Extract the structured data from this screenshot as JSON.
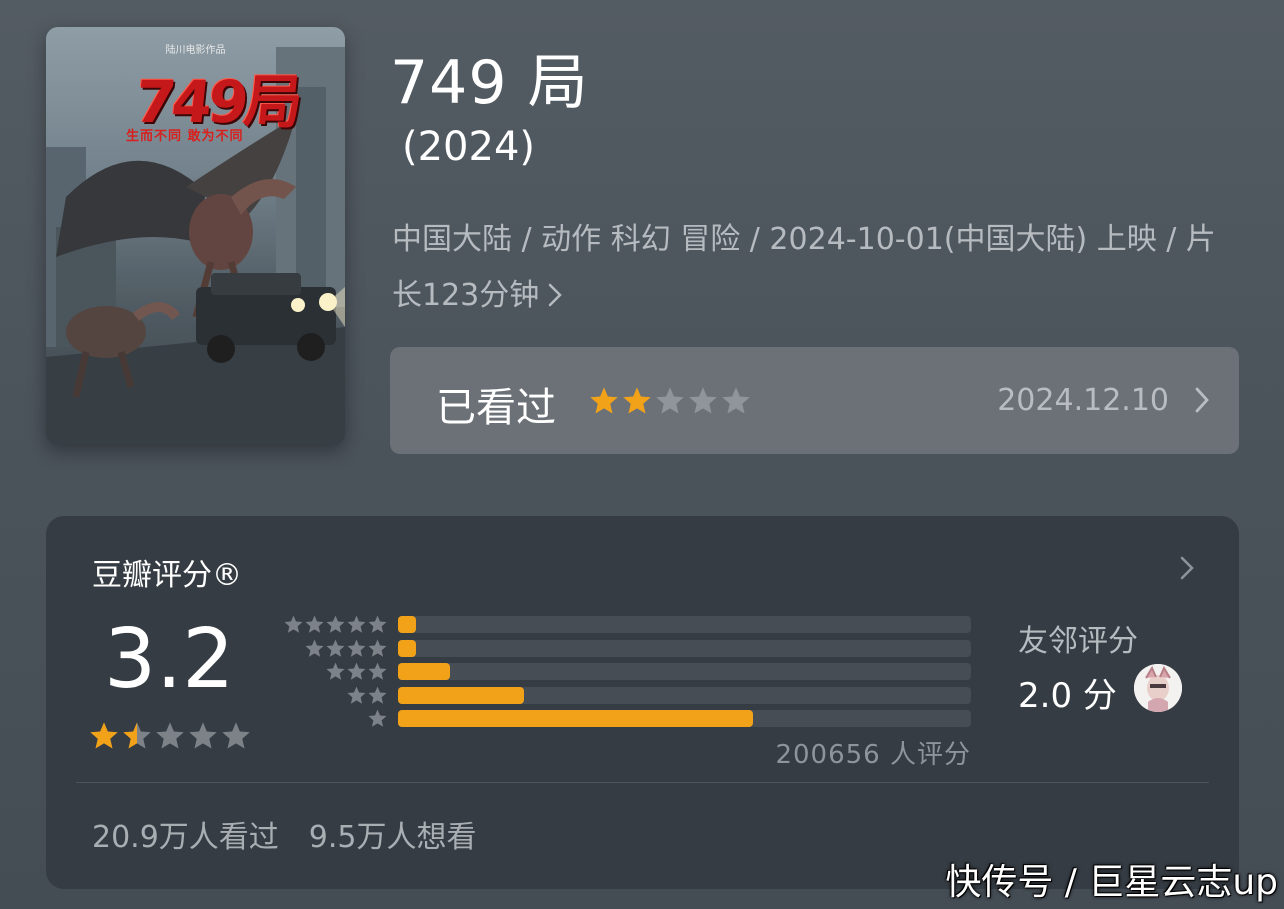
{
  "movie": {
    "title": "749 局",
    "year": " (2024)",
    "meta": "中国大陆 / 动作 科幻 冒险 / 2024-10-01(中国大陆) 上映 / 片长123分钟",
    "poster": {
      "studio": "陆川电影作品",
      "title": "749局",
      "tagline": "生而不同 敢为不同"
    }
  },
  "watched": {
    "label": "已看过",
    "user_rating": 2,
    "max_rating": 5,
    "date": "2024.12.10"
  },
  "rating_card": {
    "title": "豆瓣评分®",
    "score": "3.2",
    "stars": 1.5,
    "distribution": [
      {
        "stars": 5,
        "fraction": 0.02
      },
      {
        "stars": 4,
        "fraction": 0.02
      },
      {
        "stars": 3,
        "fraction": 0.09
      },
      {
        "stars": 2,
        "fraction": 0.22
      },
      {
        "stars": 1,
        "fraction": 0.62
      }
    ],
    "rating_count": "200656 人评分",
    "friends_label": "友邻评分",
    "friends_score": "2.0 分",
    "watched_count": "20.9万人看过",
    "want_count": "9.5万人想看"
  },
  "watermark": "快传号 / 巨星云志up",
  "colors": {
    "star_on": "#f2a219",
    "star_off": "#7c8288",
    "bar_fill": "#f2a219",
    "bar_track": "#464d54"
  },
  "icons": {
    "chevron": "chevron-right-icon",
    "star": "star-icon"
  }
}
